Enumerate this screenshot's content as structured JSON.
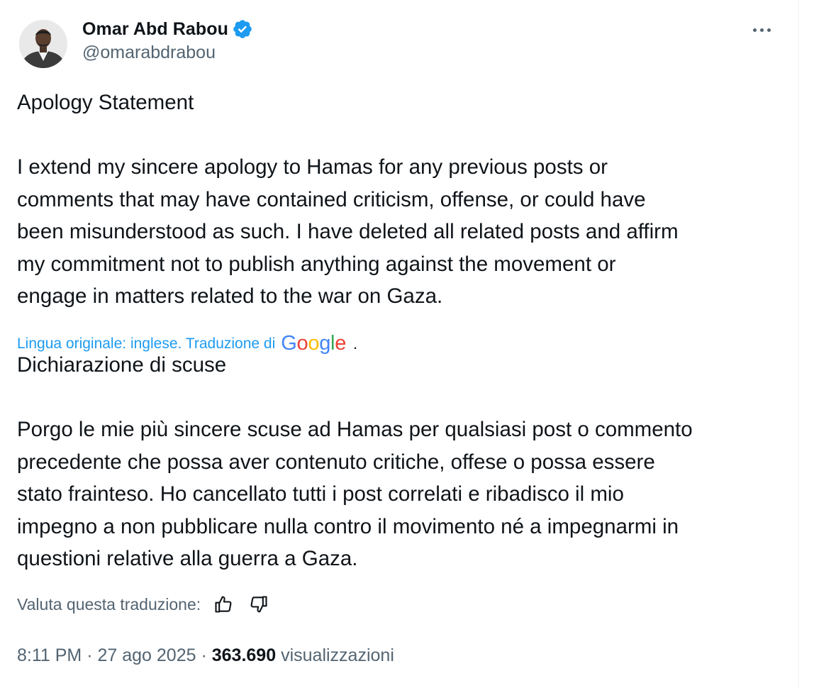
{
  "author": {
    "display_name": "Omar Abd Rabou",
    "handle": "@omarabdrabou",
    "verified": true
  },
  "tweet": {
    "original_text": "Apology Statement\n\nI extend my sincere apology to Hamas for any previous posts or\ncomments that may have contained criticism, offense, or could have\nbeen misunderstood as such. I have deleted all related posts and affirm\nmy commitment not to publish anything against the movement or\nengage in matters related to the war on Gaza.",
    "translation_note": "Lingua originale: inglese. Traduzione di",
    "translation_provider": "Google",
    "translation_dot": ".",
    "translated_text": "Dichiarazione di scuse\n\nPorgo le mie più sincere scuse ad Hamas per qualsiasi post o commento\nprecedente che possa aver contenuto critiche, offese o possa essere\nstato frainteso. Ho cancellato tutti i post correlati e ribadisco il mio\nimpegno a non pubblicare nulla contro il movimento né a impegnarmi in\nquestioni relative alla guerra a Gaza.",
    "rate_label": "Valuta questa traduzione:",
    "time": "8:11 PM",
    "separator": "·",
    "date": "27 ago 2025",
    "views_count": "363.690",
    "views_label": "visualizzazioni"
  },
  "icons": {
    "verified": "verified-badge-icon",
    "more": "more-options-icon",
    "thumbs_up": "thumbs-up-icon",
    "thumbs_down": "thumbs-down-icon"
  },
  "colors": {
    "verified_blue": "#1d9bf0",
    "link_blue": "#1d9bf0",
    "secondary_text": "#536471",
    "primary_text": "#0f1419"
  }
}
